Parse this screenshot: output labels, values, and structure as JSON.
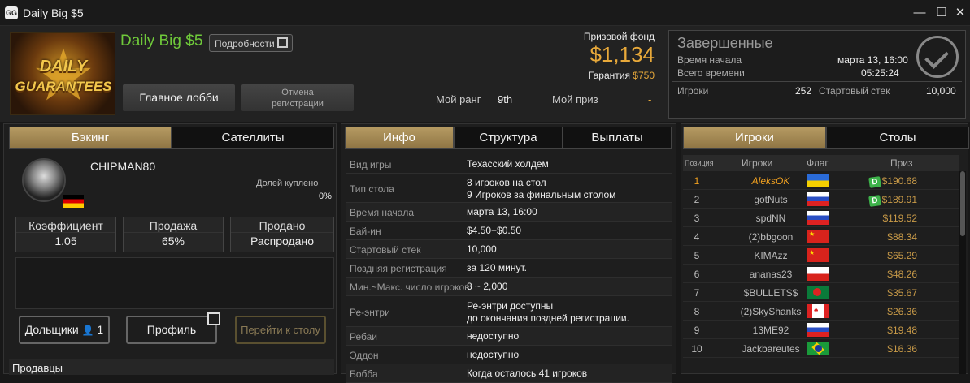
{
  "window": {
    "title": "Daily Big $5",
    "icon": "GG",
    "controls": [
      "—",
      "☐",
      "✕"
    ]
  },
  "tournament": {
    "logo_line1": "DAILY",
    "logo_line2": "GUARANTEES",
    "name": "Daily Big $5",
    "details_label": "Подробности",
    "main_lobby_label": "Главное лобби",
    "unregister_line1": "Отмена",
    "unregister_line2": "регистрации",
    "prize_label": "Призовой фонд",
    "prize": "$1,134",
    "guarantee_label": "Гарантия",
    "guarantee": "$750",
    "my_rank_label": "Мой ранг",
    "my_rank": "9th",
    "my_prize_label": "Мой приз",
    "my_prize": "-"
  },
  "status": {
    "title": "Завершенные",
    "start_label": "Время начала",
    "start_value": "марта 13, 16:00",
    "total_label": "Всего времени",
    "total_value": "05:25:24",
    "players_label": "Игроки",
    "players_value": "252",
    "stack_label": "Стартовый стек",
    "stack_value": "10,000"
  },
  "left": {
    "tabs": [
      "Бэкинг",
      "Сателлиты"
    ],
    "player_name": "CHIPMAN80",
    "bought_label": "Долей куплено",
    "bought_value": "0%",
    "stats": [
      {
        "h": "Коэффициент",
        "v": "1.05"
      },
      {
        "h": "Продажа",
        "v": "65%"
      },
      {
        "h": "Продано",
        "v": "Распродано"
      }
    ],
    "backers_label": "Дольщики",
    "backers_count": "1",
    "profile_label": "Профиль",
    "go_table_label": "Перейти к столу",
    "sellers_label": "Продавцы"
  },
  "middle": {
    "tabs": [
      "Инфо",
      "Структура",
      "Выплаты"
    ],
    "rows": [
      {
        "k": "Вид игры",
        "v": "Техасский холдем"
      },
      {
        "k": "Тип стола",
        "v": "8 игроков на стол",
        "v2": "9 Игроков за финальным столом"
      },
      {
        "k": "Время начала",
        "v": "марта 13, 16:00"
      },
      {
        "k": "Бай-ин",
        "v": "$4.50+$0.50"
      },
      {
        "k": "Стартовый стек",
        "v": "10,000"
      },
      {
        "k": "Поздняя регистрация",
        "v": "за 120 минут."
      },
      {
        "k": "Мин.~Макс. число игроков",
        "v": "8 ~ 2,000"
      },
      {
        "k": "Ре-энтри",
        "v": "Ре-энтри доступны",
        "v2": "до окончания поздней регистрации."
      },
      {
        "k": "Ребаи",
        "v": "недоступно"
      },
      {
        "k": "Эддон",
        "v": "недоступно"
      },
      {
        "k": "Бобба",
        "v": "Когда осталось 41 игроков"
      }
    ]
  },
  "right": {
    "tabs": [
      "Игроки",
      "Столы"
    ],
    "headers": [
      "Позиция",
      "Игроки",
      "Флаг",
      "Приз"
    ],
    "players": [
      {
        "pos": "1",
        "name": "AleksOK",
        "prize": "$190.68",
        "flag": "ua",
        "badge": "D"
      },
      {
        "pos": "2",
        "name": "gotNuts",
        "prize": "$189.91",
        "flag": "ru",
        "badge": "D"
      },
      {
        "pos": "3",
        "name": "spdNN",
        "prize": "$119.52",
        "flag": "ru",
        "badge": ""
      },
      {
        "pos": "4",
        "name": "(2)bbgoon",
        "prize": "$88.34",
        "flag": "cn",
        "badge": ""
      },
      {
        "pos": "5",
        "name": "KIMAzz",
        "prize": "$65.29",
        "flag": "cn",
        "badge": ""
      },
      {
        "pos": "6",
        "name": "ananas23",
        "prize": "$48.26",
        "flag": "pl",
        "badge": ""
      },
      {
        "pos": "7",
        "name": "$BULLETS$",
        "prize": "$35.67",
        "flag": "bd",
        "badge": ""
      },
      {
        "pos": "8",
        "name": "(2)SkyShanks",
        "prize": "$26.36",
        "flag": "ca",
        "badge": ""
      },
      {
        "pos": "9",
        "name": "13ME92",
        "prize": "$19.48",
        "flag": "ru",
        "badge": ""
      },
      {
        "pos": "10",
        "name": "Jackbareutes",
        "prize": "$16.36",
        "flag": "br",
        "badge": ""
      }
    ]
  },
  "colors": {
    "accent": "#b59a62",
    "prize": "#e8a93a",
    "name_green": "#6fc93a",
    "me": "#f0a020"
  }
}
